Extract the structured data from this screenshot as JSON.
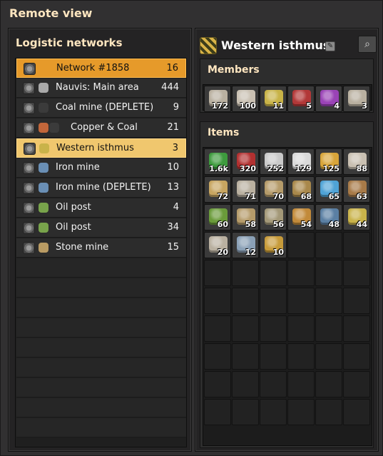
{
  "window": {
    "title": "Remote view"
  },
  "left": {
    "title": "Logistic networks",
    "rows": [
      {
        "name": "Network #1858",
        "count": "16",
        "state": "selected",
        "icons": []
      },
      {
        "name": "Nauvis: Main area",
        "count": "444",
        "state": "",
        "icons": [
          "robot-icon"
        ]
      },
      {
        "name": "Coal mine (DEPLETE)",
        "count": "9",
        "state": "",
        "icons": [
          "coal-icon"
        ]
      },
      {
        "name": "Copper & Coal",
        "count": "21",
        "state": "",
        "icons": [
          "copper-ore-icon",
          "coal-icon"
        ]
      },
      {
        "name": "Western isthmus",
        "count": "3",
        "state": "hl",
        "icons": [
          "hazard-concrete-icon"
        ]
      },
      {
        "name": "Iron mine",
        "count": "10",
        "state": "",
        "icons": [
          "iron-ore-icon"
        ]
      },
      {
        "name": "Iron mine (DEPLETE)",
        "count": "13",
        "state": "",
        "icons": [
          "iron-ore-icon"
        ]
      },
      {
        "name": "Oil post",
        "count": "4",
        "state": "",
        "icons": [
          "pumpjack-icon"
        ]
      },
      {
        "name": "Oil post",
        "count": "34",
        "state": "",
        "icons": [
          "pumpjack-icon"
        ]
      },
      {
        "name": "Stone mine",
        "count": "15",
        "state": "",
        "icons": [
          "stone-icon"
        ]
      }
    ],
    "empty_rows": 9
  },
  "right": {
    "network_title": "Western isthmus",
    "members_title": "Members",
    "items_title": "Items",
    "members": [
      {
        "icon": "roboport-icon",
        "qty": "172",
        "color": "#b9b0a0"
      },
      {
        "icon": "construction-robot-icon",
        "qty": "100",
        "color": "#c9c0b2"
      },
      {
        "icon": "passive-provider-chest-icon",
        "qty": "11",
        "color": "#c8b347"
      },
      {
        "icon": "active-provider-chest-icon",
        "qty": "5",
        "color": "#b23838"
      },
      {
        "icon": "storage-chest-icon",
        "qty": "4",
        "color": "#9a43b6"
      },
      {
        "icon": "logistic-robot-icon",
        "qty": "3",
        "color": "#b9b0a0"
      }
    ],
    "items": [
      {
        "icon": "rail-icon",
        "qty": "1.6k",
        "color": "#3e9b3e"
      },
      {
        "icon": "curved-rail-icon",
        "qty": "320",
        "color": "#b23030"
      },
      {
        "icon": "repair-pack-icon",
        "qty": "252",
        "color": "#c9c9c9"
      },
      {
        "icon": "steam-engine-icon",
        "qty": "129",
        "color": "#d9d9d9"
      },
      {
        "icon": "transport-belt-icon",
        "qty": "125",
        "color": "#d8a53a"
      },
      {
        "icon": "construction-robot-icon",
        "qty": "88",
        "color": "#c9c0b2"
      },
      {
        "icon": "rail-signal-icon",
        "qty": "72",
        "color": "#c7a560"
      },
      {
        "icon": "roboport-icon",
        "qty": "71",
        "color": "#b9b0a0"
      },
      {
        "icon": "pipe-icon",
        "qty": "70",
        "color": "#b59b6a"
      },
      {
        "icon": "pump-icon",
        "qty": "68",
        "color": "#a9884b"
      },
      {
        "icon": "inserter-icon",
        "qty": "65",
        "color": "#4fa3d6"
      },
      {
        "icon": "small-electric-pole-icon",
        "qty": "63",
        "color": "#a77a48"
      },
      {
        "icon": "traffic-light-icon",
        "qty": "60",
        "color": "#6a9b3a"
      },
      {
        "icon": "pipe-to-ground-icon",
        "qty": "58",
        "color": "#b59b6a"
      },
      {
        "icon": "gate-icon",
        "qty": "56",
        "color": "#a39878"
      },
      {
        "icon": "drill-icon",
        "qty": "54",
        "color": "#c28a3a"
      },
      {
        "icon": "radar-icon",
        "qty": "48",
        "color": "#5a7fa3"
      },
      {
        "icon": "hazard-concrete-icon",
        "qty": "44",
        "color": "#c9b34a"
      },
      {
        "icon": "logistic-robot-icon",
        "qty": "20",
        "color": "#b9b0a0"
      },
      {
        "icon": "big-electric-pole-icon",
        "qty": "12",
        "color": "#8aa0b6"
      },
      {
        "icon": "engine-icon",
        "qty": "10",
        "color": "#c79b3a"
      }
    ]
  },
  "icons": {
    "edit": "✎",
    "search": "⌕"
  }
}
